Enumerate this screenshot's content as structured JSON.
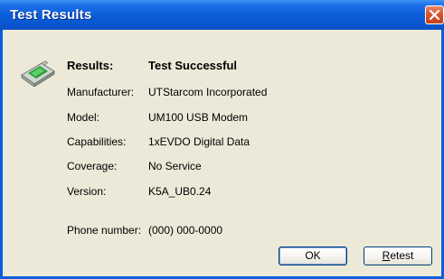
{
  "window": {
    "title": "Test Results",
    "close_icon": "close-icon"
  },
  "icon": "usb-modem-icon",
  "results": {
    "label": "Results:",
    "value": "Test Successful"
  },
  "fields": [
    {
      "label": "Manufacturer:",
      "value": "UTStarcom Incorporated"
    },
    {
      "label": "Model:",
      "value": "UM100 USB Modem"
    },
    {
      "label": "Capabilities:",
      "value": "1xEVDO Digital Data"
    },
    {
      "label": "Coverage:",
      "value": "No Service"
    },
    {
      "label": "Version:",
      "value": "K5A_UB0.24"
    }
  ],
  "phone": {
    "label": "Phone number:",
    "value": "(000) 000-0000"
  },
  "buttons": {
    "ok_label": "OK",
    "retest_mnemonic": "R",
    "retest_rest": "etest"
  },
  "colors": {
    "title_bar": "#0a5bd8",
    "window_bg": "#ece9d8",
    "close_button": "#d9542b"
  }
}
